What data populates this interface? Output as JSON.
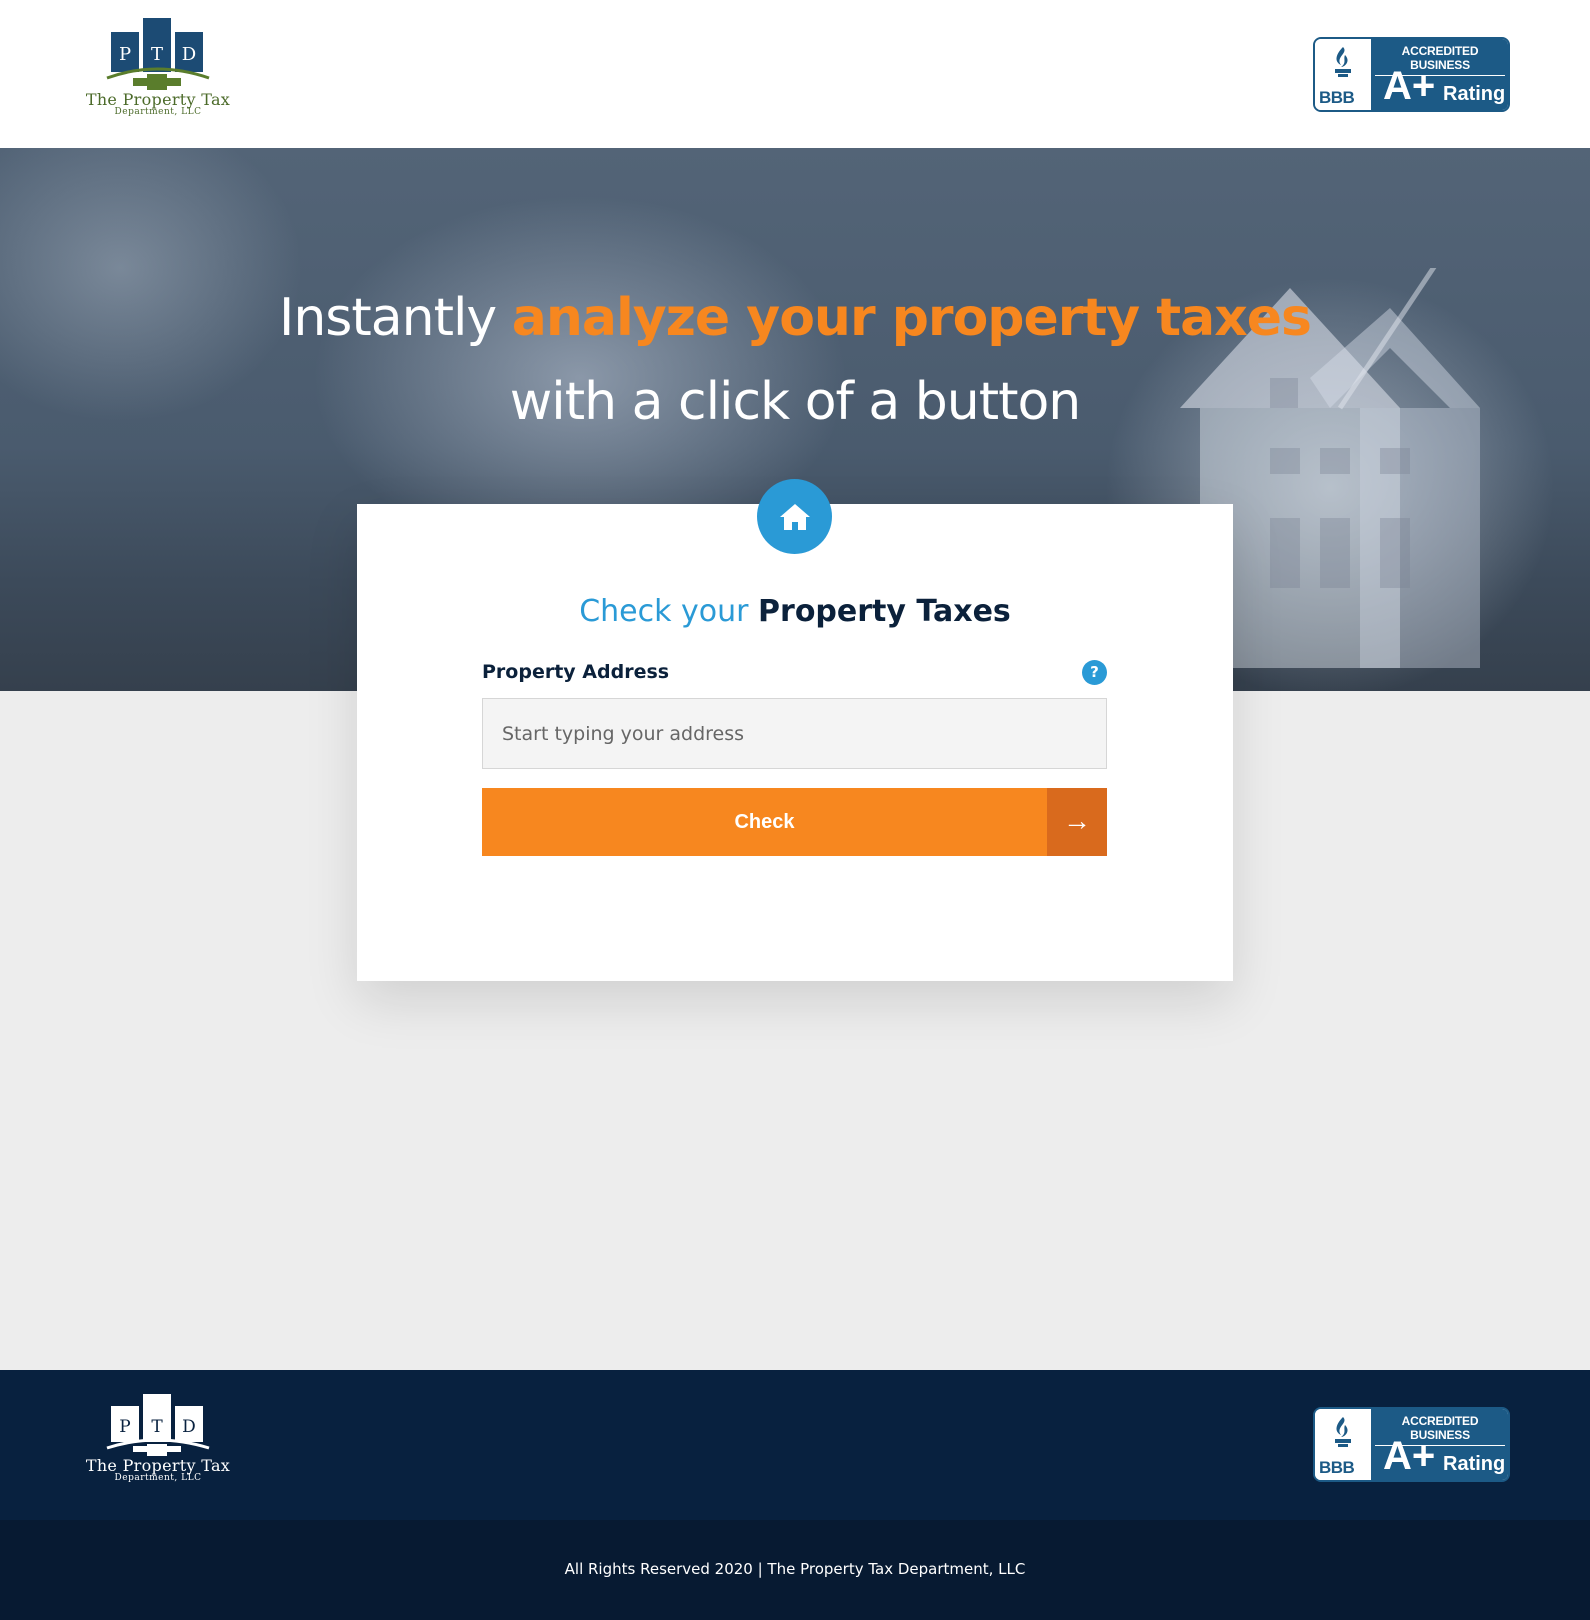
{
  "header": {
    "logo": {
      "initials": [
        "P",
        "T",
        "D"
      ],
      "name": "The Property Tax",
      "sub": "Department, LLC"
    },
    "badge": {
      "letters": "BBB",
      "accredited": "ACCREDITED BUSINESS",
      "grade": "A+",
      "rating": "Rating"
    }
  },
  "hero": {
    "line1_plain": "Instantly",
    "line1_accent": "analyze your property taxes",
    "line2": "with a click of a button"
  },
  "form": {
    "title_light": "Check your",
    "title_bold": "Property Taxes",
    "field_label": "Property Address",
    "help": "?",
    "address": {
      "value": "",
      "placeholder": "Start typing your address"
    },
    "button_label": "Check",
    "button_arrow": "→",
    "icon": "home-icon"
  },
  "footer": {
    "logo": {
      "initials": [
        "P",
        "T",
        "D"
      ],
      "name": "The Property Tax",
      "sub": "Department, LLC"
    },
    "badge": {
      "letters": "BBB",
      "accredited": "ACCREDITED BUSINESS",
      "grade": "A+",
      "rating": "Rating"
    },
    "copyright": "All Rights Reserved 2020 | The Property Tax Department, LLC"
  },
  "colors": {
    "accent_orange": "#f7871f",
    "accent_orange_dark": "#d96a1d",
    "accent_blue": "#2a9ad6",
    "navy": "#0b213b",
    "footer_navy": "#08213f",
    "bbb_blue": "#1c5a86"
  }
}
